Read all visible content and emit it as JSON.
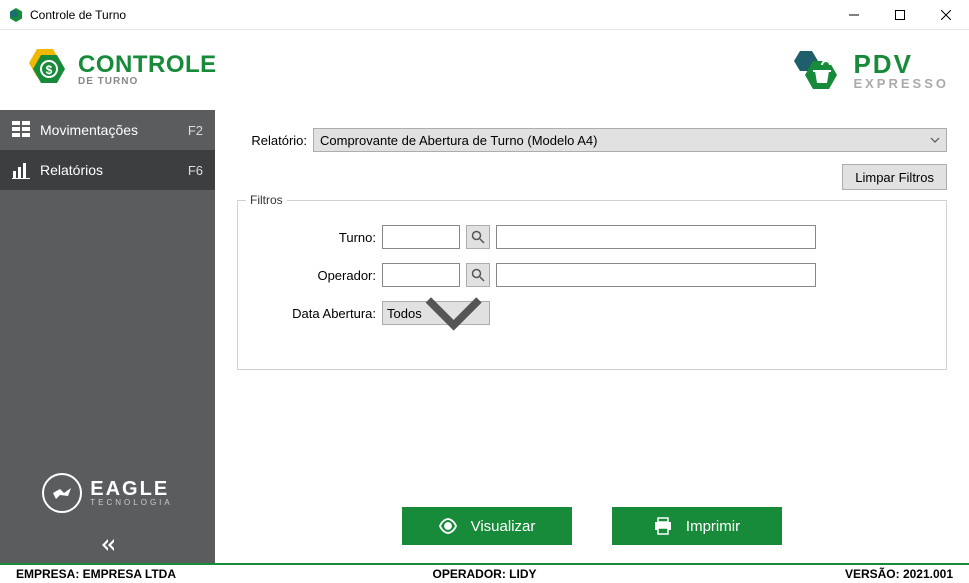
{
  "window": {
    "title": "Controle de Turno"
  },
  "header": {
    "logo_left_main": "CONTROLE",
    "logo_left_sub": "DE TURNO",
    "logo_right_main": "PDV",
    "logo_right_sub": "EXPRESSO"
  },
  "sidebar": {
    "items": [
      {
        "label": "Movimentações",
        "shortcut": "F2"
      },
      {
        "label": "Relatórios",
        "shortcut": "F6"
      }
    ],
    "eagle_main": "EAGLE",
    "eagle_sub": "TECNOLOGIA"
  },
  "content": {
    "relatorio_label": "Relatório:",
    "relatorio_value": "Comprovante de Abertura de Turno (Modelo A4)",
    "limpar_filtros": "Limpar Filtros",
    "filtros_legend": "Filtros",
    "turno_label": "Turno:",
    "turno_code": "",
    "turno_desc": "",
    "operador_label": "Operador:",
    "operador_code": "",
    "operador_desc": "",
    "data_abertura_label": "Data Abertura:",
    "data_abertura_value": "Todos",
    "visualizar": "Visualizar",
    "imprimir": "Imprimir"
  },
  "status": {
    "empresa": "EMPRESA: EMPRESA LTDA",
    "operador": "OPERADOR: LIDY",
    "versao": "VERSÃO: 2021.001"
  }
}
